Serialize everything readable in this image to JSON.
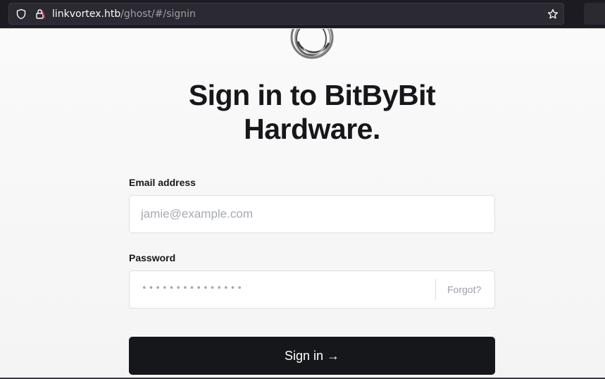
{
  "browser": {
    "url_host": "linkvortex.htb",
    "url_path": "/ghost/#/signin",
    "icons": [
      "shield-icon",
      "lock-icon",
      "star-icon"
    ]
  },
  "page": {
    "heading": "Sign in to BitByBit Hardware.",
    "email_label": "Email address",
    "email_placeholder": "jamie@example.com",
    "password_label": "Password",
    "password_value": "•••••••••••••••",
    "forgot_label": "Forgot?",
    "signin_label": "Sign in →"
  },
  "colors": {
    "accent": "#15171a",
    "background": "#f4f4f4",
    "browser_chrome": "#1c1b22"
  }
}
